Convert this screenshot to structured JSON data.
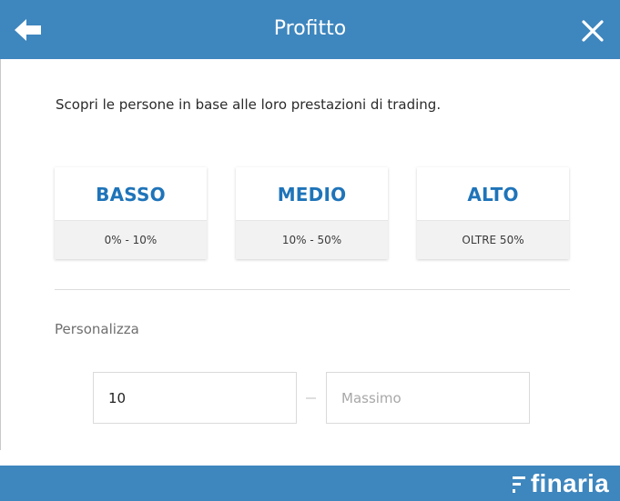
{
  "header": {
    "title": "Profitto",
    "back_icon": "arrow-left-icon",
    "close_icon": "close-icon",
    "color": "#3e86be"
  },
  "main": {
    "description": "Scopri le persone in base alle loro prestazioni di trading.",
    "options": [
      {
        "label": "BASSO",
        "range": "0% - 10%"
      },
      {
        "label": "MEDIO",
        "range": "10% - 50%"
      },
      {
        "label": "ALTO",
        "range": "OLTRE 50%"
      }
    ],
    "accent": "#1f74b9",
    "custom": {
      "label": "Personalizza",
      "min_value": "10",
      "max_placeholder": "Massimo"
    }
  },
  "footer": {
    "brand": "finaria",
    "brand_icon": "finaria-logo-icon"
  }
}
